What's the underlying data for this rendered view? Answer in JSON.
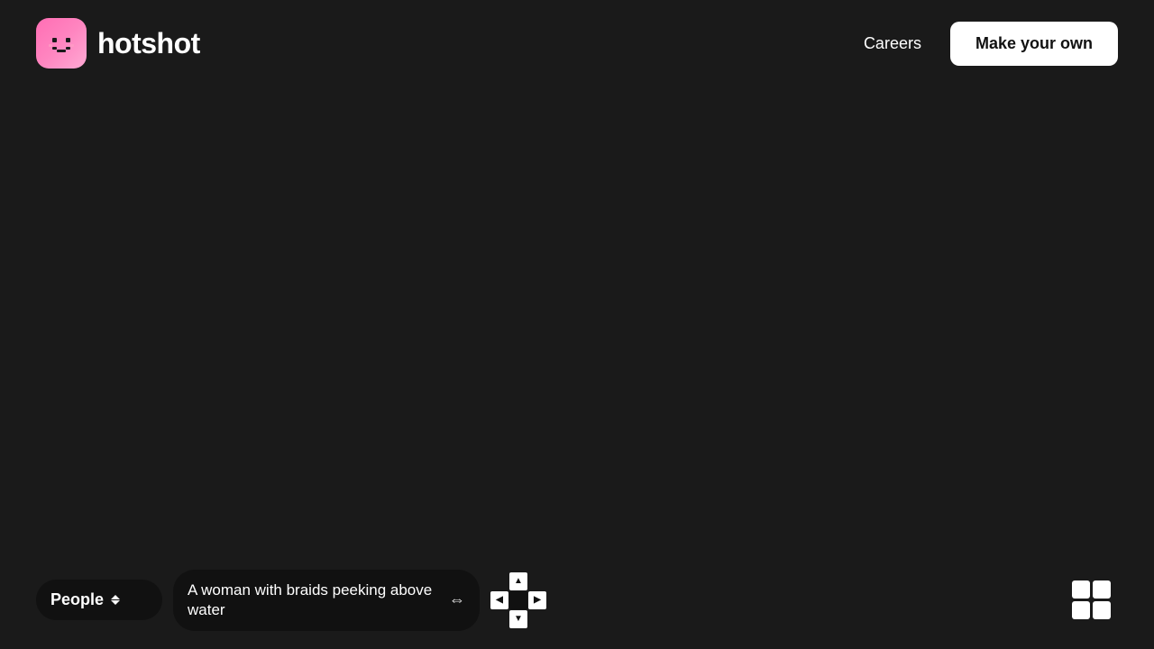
{
  "header": {
    "brand_name": "hotshot",
    "careers_label": "Careers",
    "make_your_own_label": "Make your own"
  },
  "bottom_bar": {
    "category_label": "People",
    "prompt_text": "A woman with braids peeking above water",
    "chevron_up": "▲",
    "chevron_down": "▼",
    "arrow_icon": "◀▶"
  },
  "colors": {
    "background": "#1a1a1a",
    "dark_surface": "#111111",
    "white": "#ffffff",
    "logo_gradient_start": "#ff6eb4",
    "logo_gradient_end": "#ffaad4"
  }
}
